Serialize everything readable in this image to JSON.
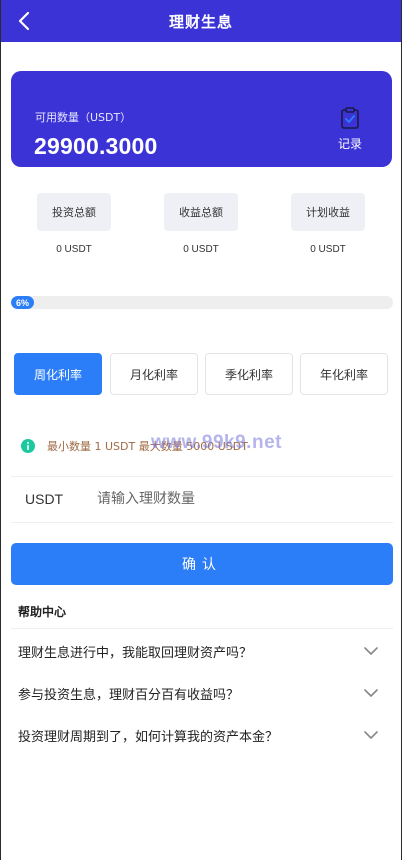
{
  "header": {
    "title": "理财生息",
    "back_icon": "chevron-left-icon"
  },
  "balance": {
    "label": "可用数量（USDT）",
    "amount": "29900.3000",
    "record_label": "记录",
    "record_icon": "clipboard-check-icon"
  },
  "stats": [
    {
      "label": "投资总额",
      "value": "0 USDT"
    },
    {
      "label": "收益总额",
      "value": "0 USDT"
    },
    {
      "label": "计划收益",
      "value": "0 USDT"
    }
  ],
  "progress": {
    "percent": 6,
    "label": "6%"
  },
  "periods": [
    {
      "label": "周化利率",
      "active": true
    },
    {
      "label": "月化利率",
      "active": false
    },
    {
      "label": "季化利率",
      "active": false
    },
    {
      "label": "年化利率",
      "active": false
    }
  ],
  "limit": {
    "text": "最小数量 1 USDT 最大数量 5000 USDT",
    "icon": "info-icon"
  },
  "watermark": "www.99k9.net",
  "amount_input": {
    "unit": "USDT",
    "placeholder": "请输入理财数量",
    "value": ""
  },
  "confirm_label": "确认",
  "help": {
    "title": "帮助中心",
    "items": [
      {
        "question": "理财生息进行中，我能取回理财资产吗？"
      },
      {
        "question": "参与投资生息，理财百分百有收益吗？"
      },
      {
        "question": "投资理财周期到了，如何计算我的资产本金？"
      }
    ]
  },
  "colors": {
    "brand": "#3b33d6",
    "accent": "#2c7ef8",
    "info": "#1cc8a0"
  }
}
